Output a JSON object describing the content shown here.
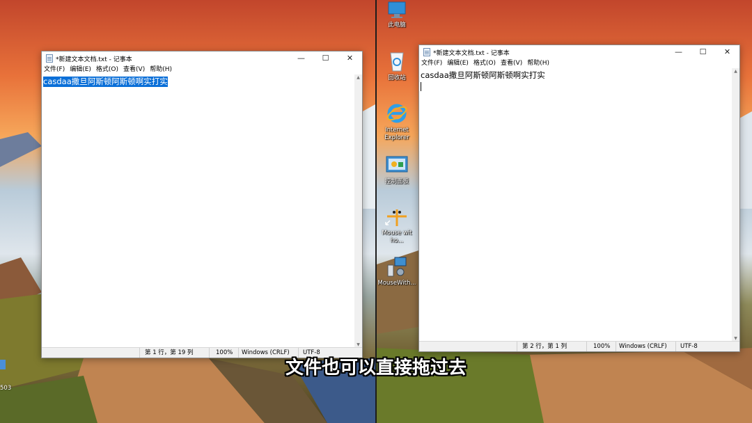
{
  "subtitle": "文件也可以直接拖过去",
  "left_window": {
    "title": "*新建文本文档.txt - 记事本",
    "menu": [
      "文件(F)",
      "编辑(E)",
      "格式(O)",
      "查看(V)",
      "帮助(H)"
    ],
    "content": "casdaa撒旦阿斯顿阿斯顿啊实打实",
    "status": {
      "position": "第 1 行，第 19 列",
      "zoom": "100%",
      "line_ending": "Windows (CRLF)",
      "encoding": "UTF-8"
    }
  },
  "right_window": {
    "title": "*新建文本文档.txt - 记事本",
    "menu": [
      "文件(F)",
      "编辑(E)",
      "格式(O)",
      "查看(V)",
      "帮助(H)"
    ],
    "content": "casdaa撒旦阿斯顿阿斯顿啊实打实",
    "status": {
      "position": "第 2 行，第 1 列",
      "zoom": "100%",
      "line_ending": "Windows (CRLF)",
      "encoding": "UTF-8"
    }
  },
  "window_controls": {
    "minimize": "—",
    "maximize": "☐",
    "close": "✕"
  },
  "desktop_icons": [
    {
      "label": "此电脑",
      "icon": "computer-icon"
    },
    {
      "label": "回收站",
      "icon": "recycle-bin-icon"
    },
    {
      "label": "Internet Explorer",
      "icon": "internet-explorer-icon"
    },
    {
      "label": "控制面板",
      "icon": "control-panel-icon"
    },
    {
      "label": "Mouse wit ho...",
      "icon": "mouse-shortcut-icon"
    },
    {
      "label": "MouseWith...",
      "icon": "mousewith-app-icon"
    }
  ],
  "left_edge_label": "503"
}
